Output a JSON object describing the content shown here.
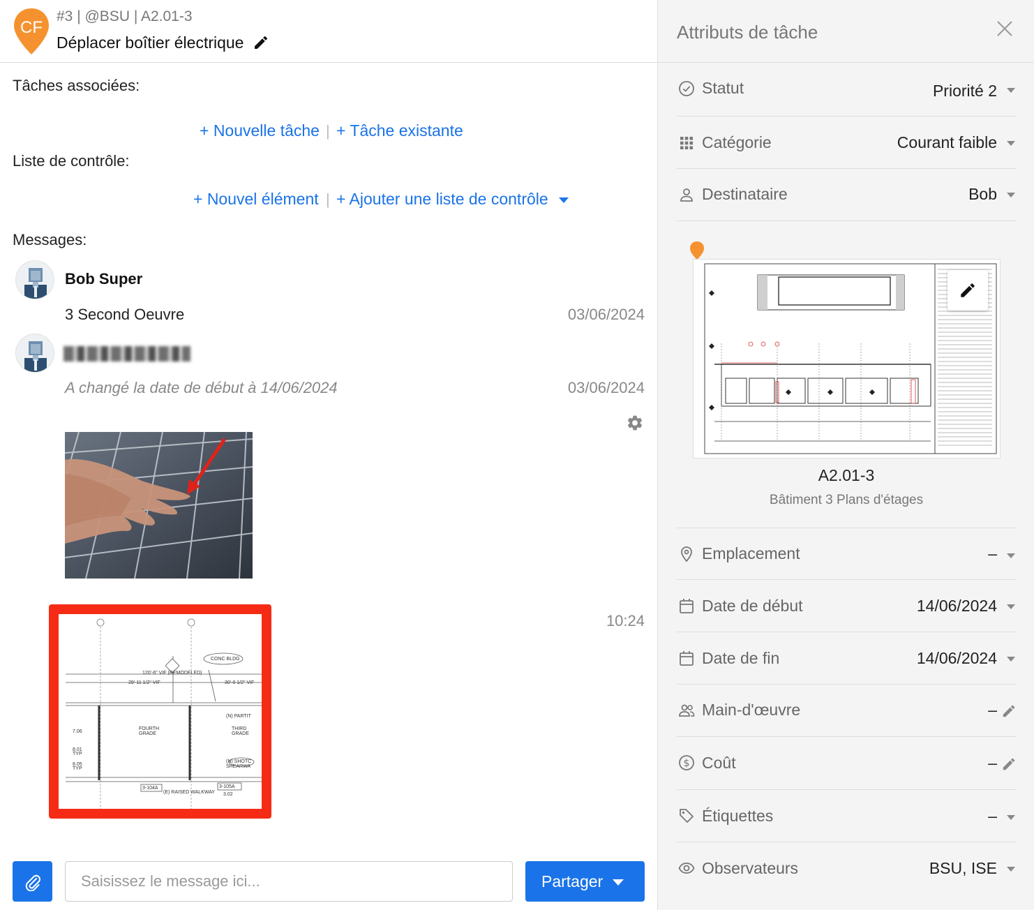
{
  "header": {
    "avatar_initials": "CF",
    "task_ref": "#3 | @BSU | A2.01-3",
    "task_title": "Déplacer boîtier électrique"
  },
  "related_tasks": {
    "label": "Tâches associées:",
    "new_task": "+ Nouvelle tâche",
    "existing_task": "+ Tâche existante",
    "separator": "|"
  },
  "checklist": {
    "label": "Liste de contrôle:",
    "new_item": "+ Nouvel élément",
    "add_checklist": "+ Ajouter une liste de contrôle",
    "separator": "|"
  },
  "messages": {
    "label": "Messages:",
    "items": [
      {
        "author": "Bob Super",
        "text": "3 Second Oeuvre",
        "date": "03/06/2024"
      },
      {
        "author": "",
        "text": "A changé la date de début à 14/06/2024",
        "date": "03/06/2024"
      },
      {
        "time": "10:24"
      }
    ]
  },
  "composer": {
    "placeholder": "Saisissez le message ici...",
    "share_label": "Partager"
  },
  "panel": {
    "title": "Attributs de tâche",
    "attributes": [
      {
        "label": "Statut",
        "value": "Priorité 2",
        "icon": "check-circle-icon"
      },
      {
        "label": "Catégorie",
        "value": "Courant faible",
        "icon": "grid-icon"
      },
      {
        "label": "Destinataire",
        "value": "Bob",
        "icon": "person-icon"
      },
      {
        "label": "Emplacement",
        "value": "–",
        "icon": "location-pin-icon"
      },
      {
        "label": "Date de début",
        "value": "14/06/2024",
        "icon": "calendar-icon"
      },
      {
        "label": "Date de fin",
        "value": "14/06/2024",
        "icon": "calendar-icon"
      },
      {
        "label": "Main-d'œuvre",
        "value": "–",
        "icon": "people-icon"
      },
      {
        "label": "Coût",
        "value": "–",
        "icon": "dollar-icon"
      },
      {
        "label": "Étiquettes",
        "value": "–",
        "icon": "tag-icon"
      },
      {
        "label": "Observateurs",
        "value": "BSU, ISE",
        "icon": "eye-icon"
      }
    ],
    "plan": {
      "code": "A2.01-3",
      "name": "Bâtiment 3 Plans d'étages"
    }
  },
  "colors": {
    "accent": "#1a73e8",
    "pin": "#f5922f",
    "highlight_border": "#f52b16"
  }
}
